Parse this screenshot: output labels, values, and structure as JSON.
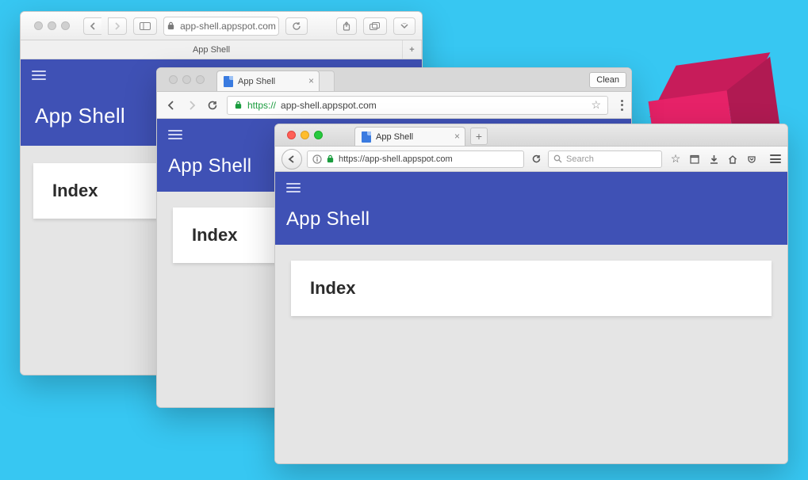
{
  "app": {
    "header_title": "App Shell",
    "content_heading": "Index"
  },
  "safari": {
    "url_display": "app-shell.appspot.com",
    "tab_title": "App Shell",
    "new_tab_label": "+"
  },
  "chrome": {
    "tab_title": "App Shell",
    "clean_button_label": "Clean",
    "url_protocol": "https://",
    "url_rest": "app-shell.appspot.com"
  },
  "firefox": {
    "tab_title": "App Shell",
    "new_tab_label": "+",
    "url": "https://app-shell.appspot.com",
    "search_placeholder": "Search"
  }
}
